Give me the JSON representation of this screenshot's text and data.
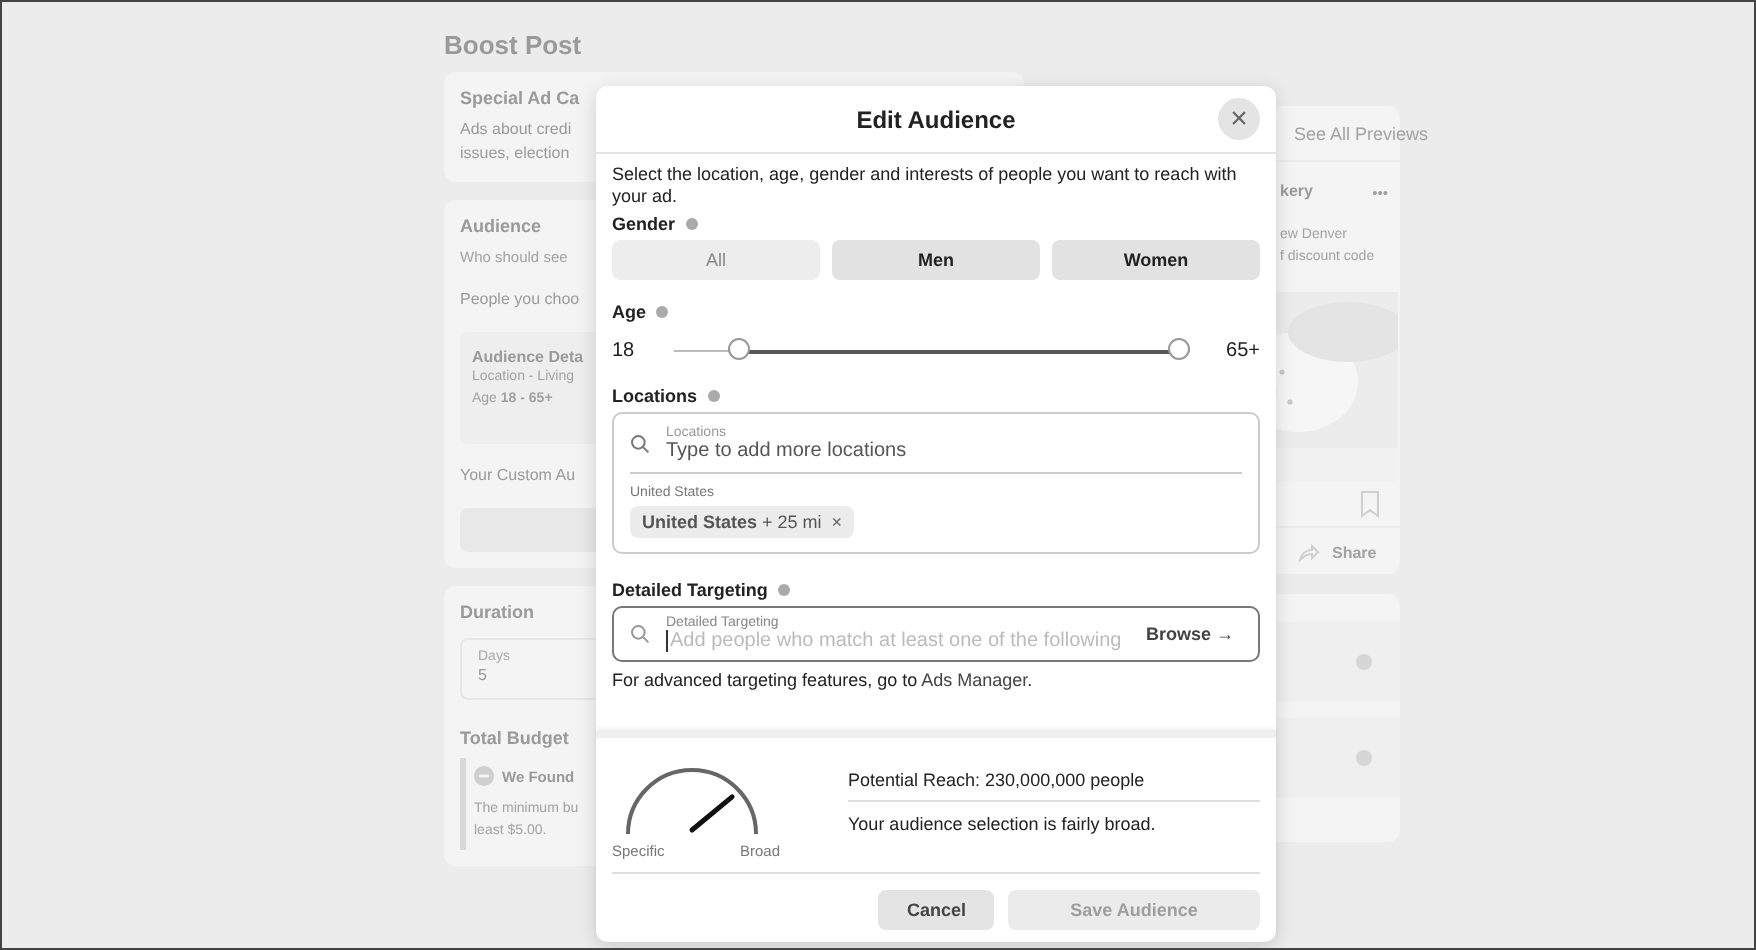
{
  "page": {
    "title": "Boost Post",
    "special_card": {
      "title": "Special Ad Ca",
      "lines": [
        "Ads about credi",
        "issues, election"
      ]
    },
    "audience_card": {
      "title": "Audience",
      "subtitle": "Who should see",
      "text": "People you choo",
      "details": {
        "title": "Audience Deta",
        "location": "Location - Living",
        "age": "Age **18 - 65+**"
      },
      "custom": "Your Custom Au"
    },
    "duration_card": {
      "title": "Duration",
      "days_label": "Days",
      "days_value": "5",
      "budget_title": "Total Budget",
      "notice_title": "We Found",
      "notice_lines": [
        "The minimum bu",
        "least $5.00."
      ]
    },
    "preview_card": {
      "link": "See All Previews",
      "page_name": "kery",
      "more": "•••",
      "lines": [
        "ew Denver",
        "f discount code"
      ],
      "share": "Share",
      "picture": {
        "kind": "picture"
      }
    },
    "info_rows": [
      {
        "kind": "info"
      },
      {
        "kind": "info"
      }
    ]
  },
  "dialog": {
    "title": "Edit Audience",
    "close": "×",
    "description": "Select the location, age, gender and interests of people you want to reach with your ad.",
    "gender": {
      "label": "Gender",
      "options": [
        {
          "label": "All",
          "selected": true
        },
        {
          "label": "Men",
          "selected": false
        },
        {
          "label": "Women",
          "selected": false
        }
      ]
    },
    "age": {
      "label": "Age",
      "min": "18",
      "max": "65+",
      "thumbs": [
        {
          "level": 0.11
        },
        {
          "level": 1
        }
      ]
    },
    "locations": {
      "label": "Locations",
      "field_label": "Locations",
      "placeholder": "Type to add more locations",
      "group_label": "United States",
      "chips": [
        {
          "text": "**United States** + 25 mi",
          "remove": "×"
        }
      ]
    },
    "targeting": {
      "label": "Detailed Targeting",
      "field_label": "Detailed Targeting",
      "placeholder": "Add people who match at least one of the following",
      "browse": "Browse →",
      "note": "For advanced targeting features, go to ",
      "link": "Ads Manager",
      "note_end": "."
    },
    "reach": {
      "level": 0.78,
      "specific": "Specific",
      "broad": "Broad",
      "reach": "Potential Reach: 230,000,000 people",
      "summary": "Your audience selection is fairly broad."
    },
    "buttons": [
      {
        "label": "Cancel",
        "disabled": false
      },
      {
        "label": "Save Audience",
        "disabled": true
      }
    ]
  }
}
